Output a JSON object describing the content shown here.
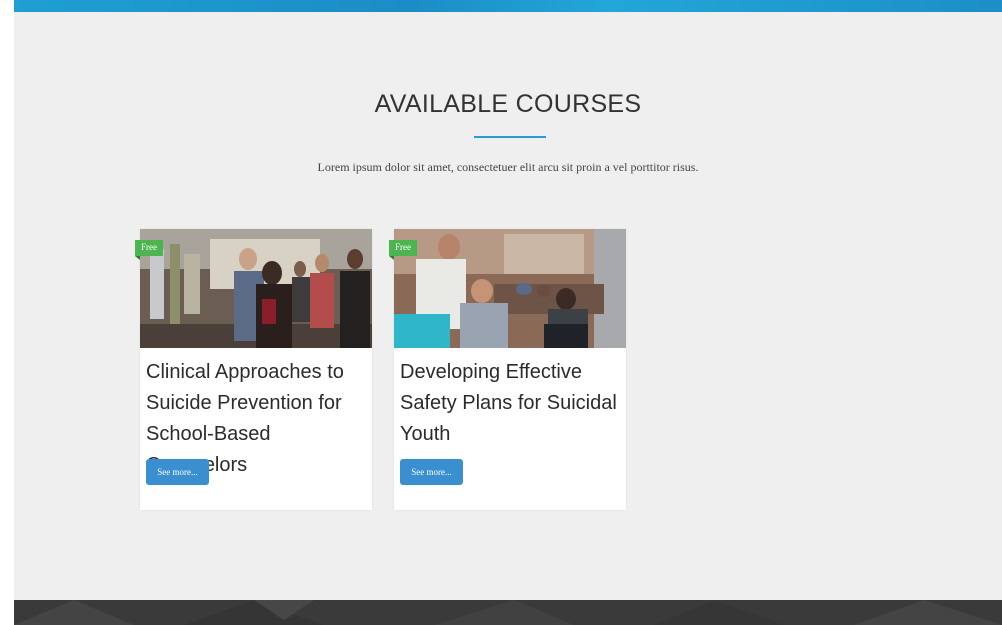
{
  "section": {
    "title": "AVAILABLE COURSES",
    "subtitle": "Lorem ipsum dolor sit amet, consectetuer elit arcu sit proin a vel porttitor risus."
  },
  "courses": [
    {
      "badge": "Free",
      "title": "Clinical Approaches to Suicide Prevention for School-Based Counselors",
      "button_label": "See more..."
    },
    {
      "badge": "Free",
      "title": "Developing Effective Safety Plans for Suicidal Youth",
      "button_label": "See more..."
    }
  ],
  "colors": {
    "accent": "#2b9bd6",
    "badge": "#4cb54f",
    "button": "#3a8fd0",
    "background": "#efefef",
    "footer": "#3a3a3a"
  }
}
